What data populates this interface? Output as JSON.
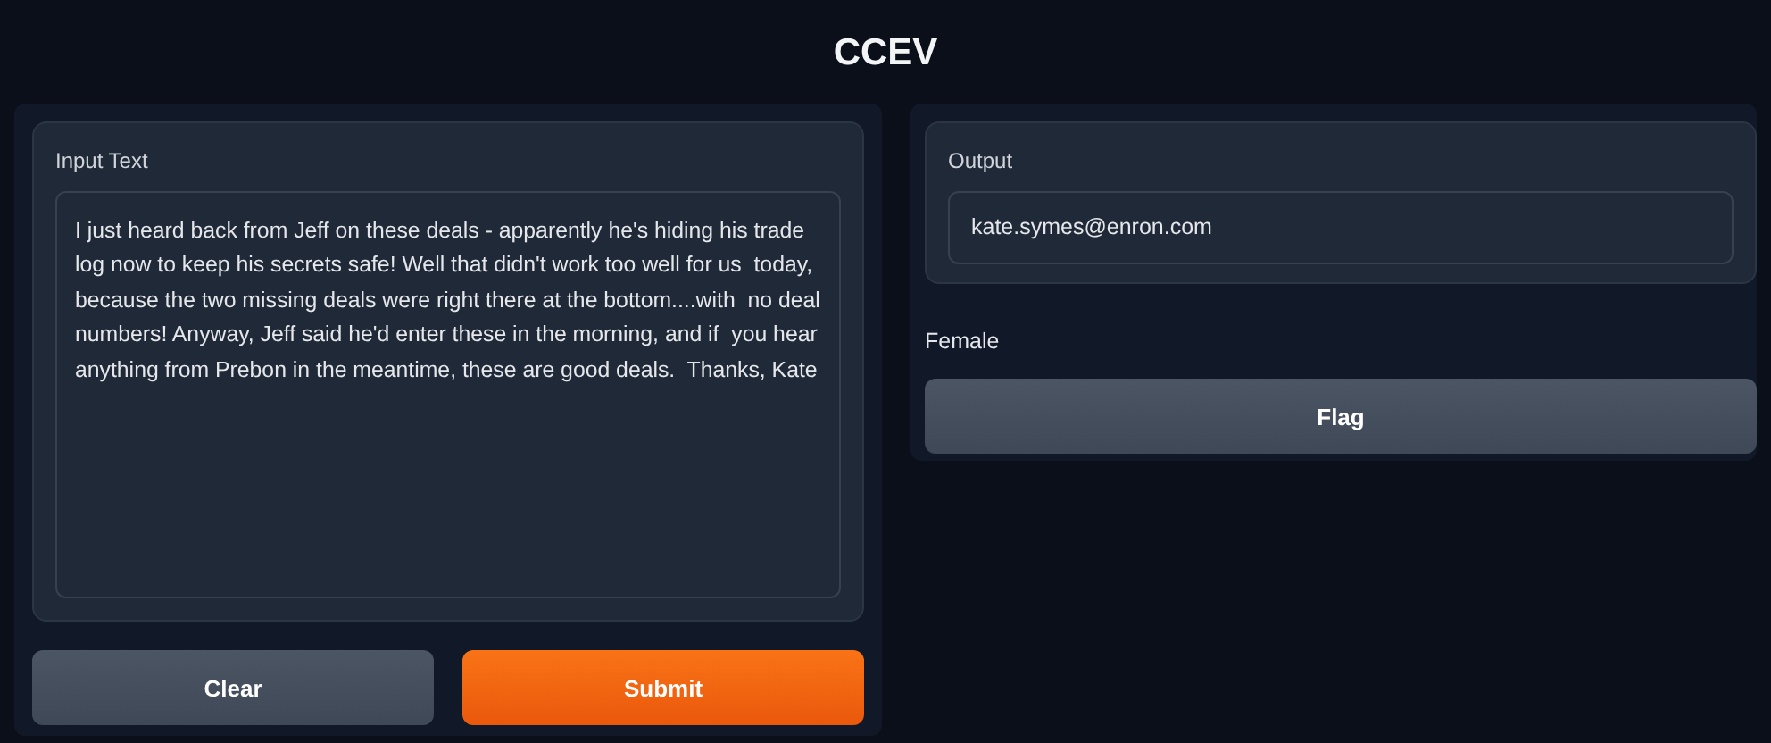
{
  "title": "CCEV",
  "input": {
    "label": "Input Text",
    "value": "I just heard back from Jeff on these deals - apparently he's hiding his trade  log now to keep his secrets safe! Well that didn't work too well for us  today, because the two missing deals were right there at the bottom....with  no deal numbers! Anyway, Jeff said he'd enter these in the morning, and if  you hear anything from Prebon in the meantime, these are good deals.  Thanks, Kate"
  },
  "buttons": [
    {
      "label": "Clear",
      "kind": "secondary"
    },
    {
      "label": "Submit",
      "kind": "primary"
    }
  ],
  "output": {
    "label": "Output",
    "value": "kate.symes@enron.com"
  },
  "result": "Female",
  "flag_button": {
    "label": "Flag",
    "kind": "secondary"
  }
}
